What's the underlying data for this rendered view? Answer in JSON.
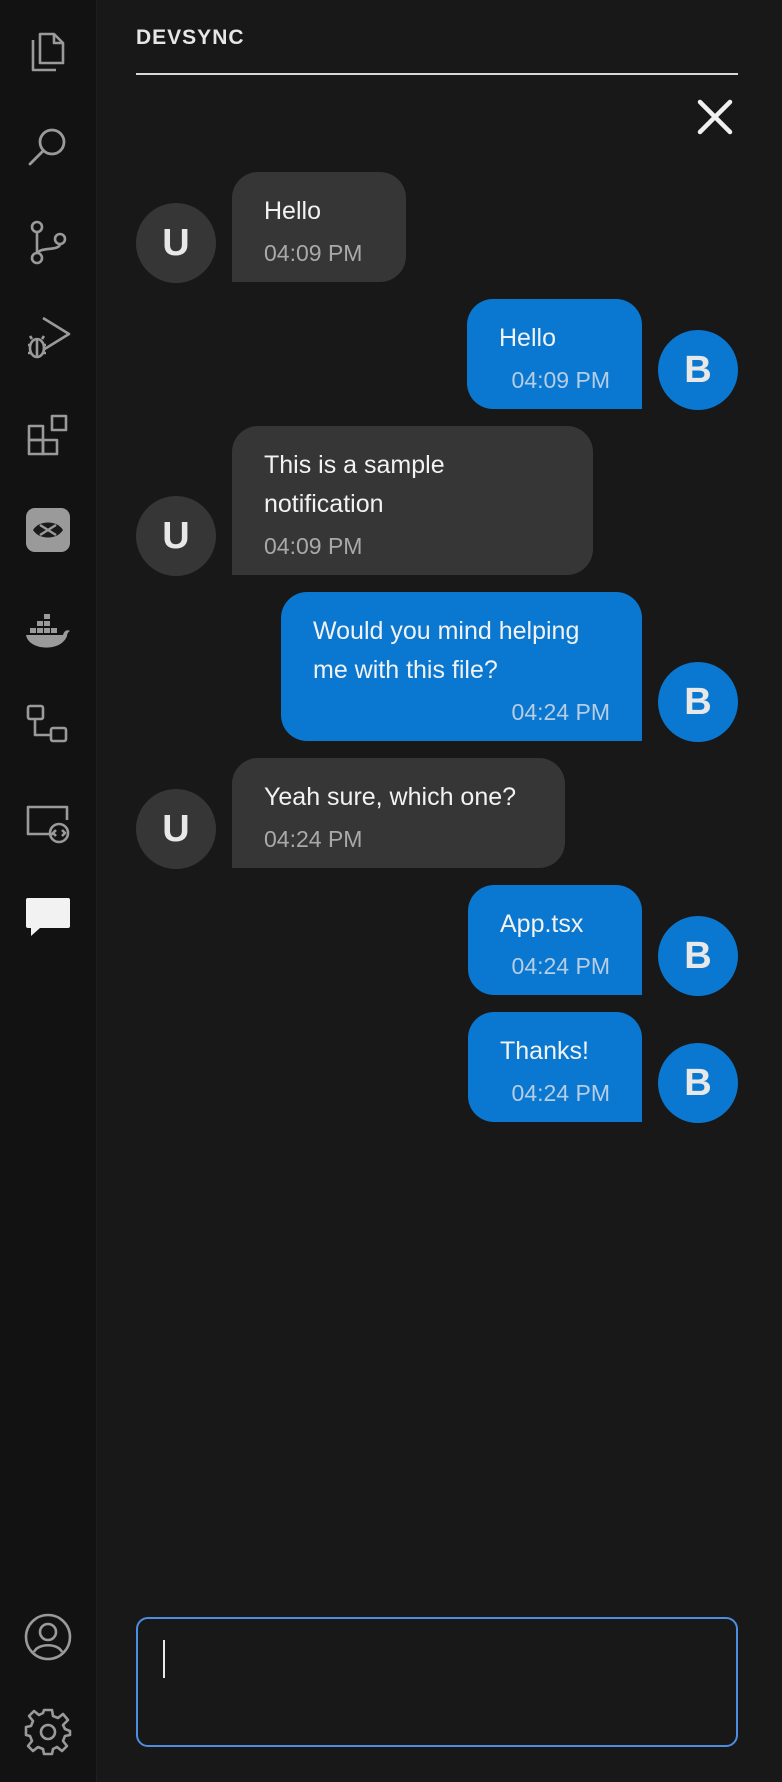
{
  "app": {
    "panel_title": "DEVSYNC",
    "colors": {
      "activity_bar_bg": "#121212",
      "panel_bg": "#181818",
      "incoming_bubble": "#363636",
      "outgoing_bubble": "#0a78d0",
      "input_border": "#4d8ee0"
    }
  },
  "activity_bar": {
    "top_icons": [
      "files-icon",
      "search-icon",
      "source-control-icon",
      "run-debug-icon",
      "extensions-icon",
      "devsync-extension-icon",
      "docker-icon",
      "workflow-icon",
      "remote-explorer-icon",
      "chat-icon"
    ],
    "bottom_icons": [
      "account-icon",
      "settings-gear-icon"
    ]
  },
  "chat": {
    "close_icon": "close-icon",
    "messages": [
      {
        "from": "incoming",
        "avatar": "U",
        "text": "Hello",
        "time": "04:09 PM"
      },
      {
        "from": "outgoing",
        "avatar": "B",
        "text": "Hello",
        "time": "04:09 PM"
      },
      {
        "from": "incoming",
        "avatar": "U",
        "text": "This is a sample notification",
        "time": "04:09 PM"
      },
      {
        "from": "outgoing",
        "avatar": "B",
        "text": "Would you mind helping me with this file?",
        "time": "04:24 PM"
      },
      {
        "from": "incoming",
        "avatar": "U",
        "text": "Yeah sure, which one?",
        "time": "04:24 PM"
      },
      {
        "from": "outgoing",
        "avatar": "B",
        "text": "App.tsx",
        "time": "04:24 PM"
      },
      {
        "from": "outgoing",
        "avatar": "B",
        "text": "Thanks!",
        "time": "04:24 PM"
      }
    ],
    "input": {
      "value": "",
      "placeholder": ""
    }
  }
}
